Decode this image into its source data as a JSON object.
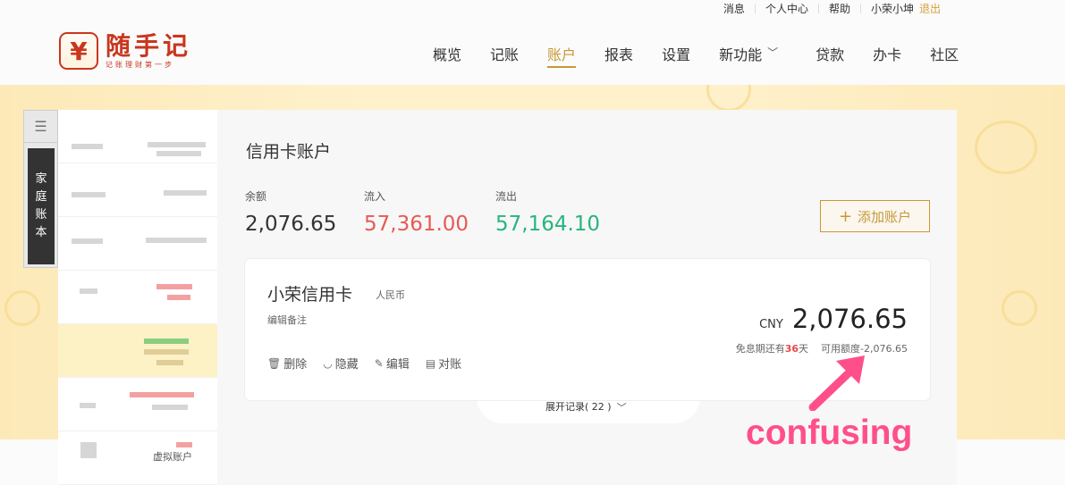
{
  "top_links": {
    "messages": "消息",
    "profile": "个人中心",
    "help": "帮助",
    "user": "小荣小坤",
    "logout": "退出"
  },
  "logo": {
    "symbol": "¥",
    "name": "随手记",
    "slogan": "记账理财第一步"
  },
  "nav": {
    "items": [
      {
        "label": "概览"
      },
      {
        "label": "记账"
      },
      {
        "label": "账户",
        "active": true
      },
      {
        "label": "报表"
      },
      {
        "label": "设置"
      },
      {
        "label": "新功能"
      },
      {
        "label": "贷款"
      },
      {
        "label": "办卡"
      },
      {
        "label": "社区"
      }
    ]
  },
  "sidebar": {
    "family_book": [
      "家",
      "庭",
      "账",
      "本"
    ],
    "virtual_account_label": "虚拟账户"
  },
  "panel": {
    "title": "信用卡账户",
    "balance_label": "余额",
    "balance": "2,076.65",
    "inflow_label": "流入",
    "inflow": "57,361.00",
    "outflow_label": "流出",
    "outflow": "57,164.10",
    "add_account": "添加账户"
  },
  "card": {
    "name": "小荣信用卡",
    "currency_label": "人民币",
    "note": "编辑备注",
    "actions": {
      "delete": "删除",
      "hide": "隐藏",
      "edit": "编辑",
      "reconcile": "对账"
    },
    "currency_code": "CNY",
    "amount": "2,076.65",
    "grace_prefix": "免息期还有",
    "grace_days": "36",
    "grace_suffix": "天",
    "available_credit": "可用额度-2,076.65"
  },
  "expand_records": "展开记录( 22 )",
  "annotation": "confusing",
  "colors": {
    "brand_red": "#c8371e",
    "accent_gold": "#c79737",
    "inflow_red": "#e65a55",
    "outflow_green": "#26b57e",
    "annotation_pink": "#ff4f8b"
  }
}
